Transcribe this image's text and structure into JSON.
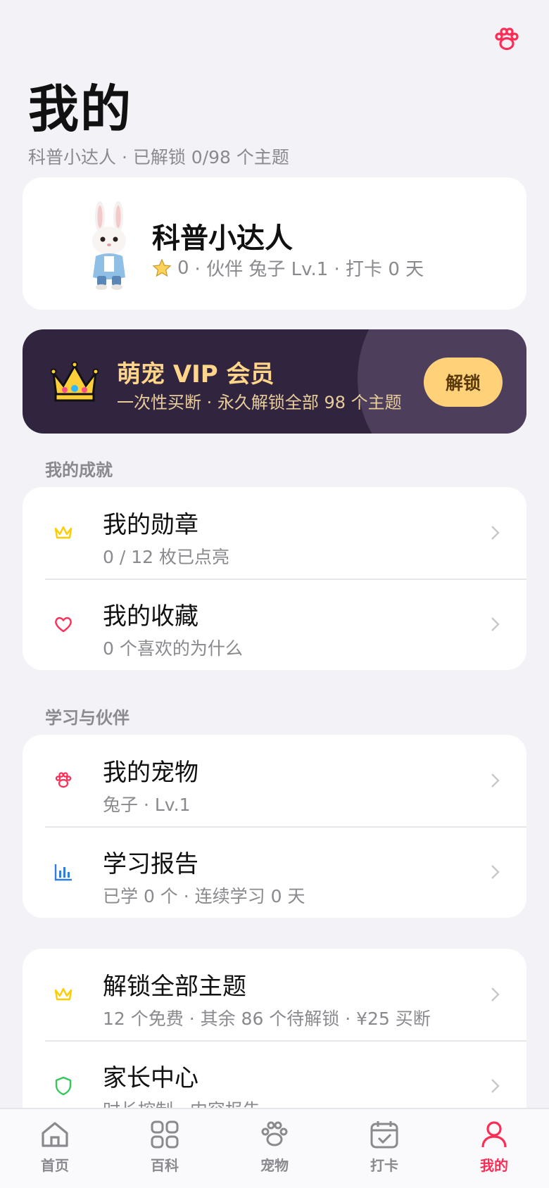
{
  "header": {
    "title": "我的",
    "subtitle": "科普小达人 · 已解锁 0/98 个主题"
  },
  "profile": {
    "name": "科普小达人",
    "stars": "0",
    "stats_rest": "· 伙伴 兔子 Lv.1 · 打卡 0 天"
  },
  "vip": {
    "title": "萌宠 VIP 会员",
    "subtitle": "一次性买断 · 永久解锁全部 98 个主题",
    "button": "解锁"
  },
  "sections": {
    "achievements": {
      "label": "我的成就",
      "items": [
        {
          "title": "我的勋章",
          "subtitle": "0 / 12 枚已点亮",
          "icon": "crown-icon"
        },
        {
          "title": "我的收藏",
          "subtitle": "0 个喜欢的为什么",
          "icon": "heart-icon"
        }
      ]
    },
    "learning": {
      "label": "学习与伙伴",
      "items": [
        {
          "title": "我的宠物",
          "subtitle": "兔子 · Lv.1",
          "icon": "paw-icon"
        },
        {
          "title": "学习报告",
          "subtitle": "已学 0 个 · 连续学习 0 天",
          "icon": "bar-chart-icon"
        }
      ]
    },
    "more": {
      "items": [
        {
          "title": "解锁全部主题",
          "subtitle": "12 个免费 · 其余 86 个待解锁 · ¥25 买断",
          "icon": "crown-icon"
        },
        {
          "title": "家长中心",
          "subtitle": "时长控制 · 内容报告",
          "icon": "shield-icon"
        }
      ]
    }
  },
  "tabbar": {
    "tabs": [
      {
        "label": "首页",
        "icon": "home-icon"
      },
      {
        "label": "百科",
        "icon": "grid-icon"
      },
      {
        "label": "宠物",
        "icon": "paw-icon"
      },
      {
        "label": "打卡",
        "icon": "calendar-check-icon"
      },
      {
        "label": "我的",
        "icon": "person-icon",
        "active": true
      }
    ]
  },
  "colors": {
    "accent": "#ff2d55",
    "gold": "#ffd27a",
    "vip_bg": "#30243f",
    "green": "#34c759",
    "blue": "#2f7de1"
  }
}
